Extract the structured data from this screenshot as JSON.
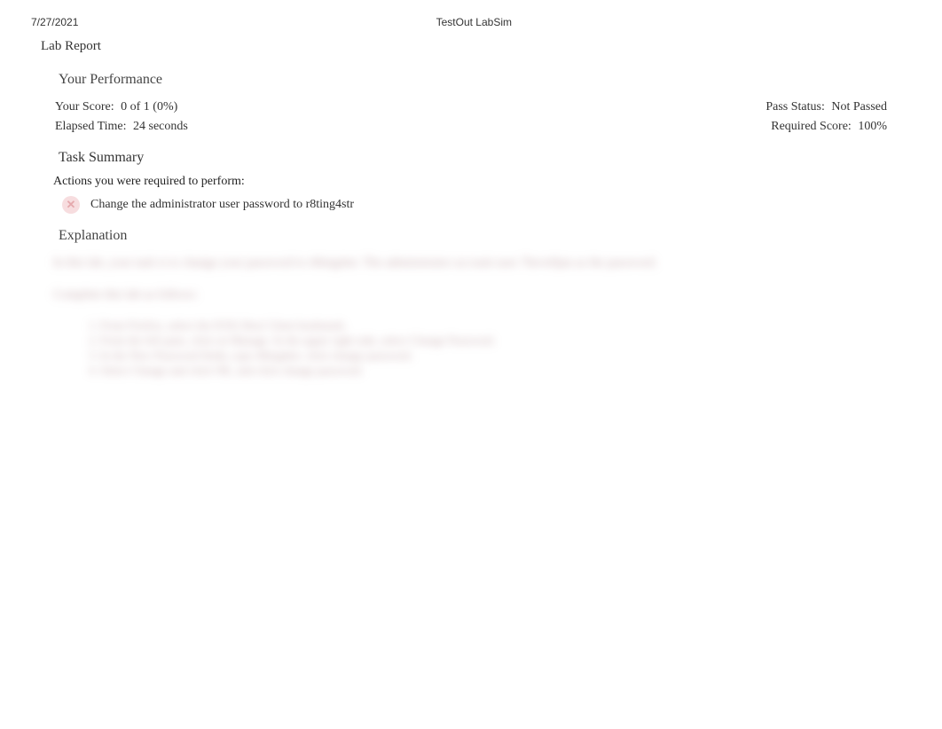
{
  "header": {
    "date": "7/27/2021",
    "app_title": "TestOut LabSim"
  },
  "report": {
    "title": "Lab Report"
  },
  "performance": {
    "section_title": "Your Performance",
    "score_label": "Your Score:",
    "score_value": "0 of 1 (0%)",
    "elapsed_label": "Elapsed Time:",
    "elapsed_value": "24 seconds",
    "pass_label": "Pass Status:",
    "pass_value": "Not Passed",
    "required_label": "Required Score:",
    "required_value": "100%"
  },
  "task_summary": {
    "section_title": "Task Summary",
    "actions_label": "Actions you were required to perform:",
    "task_1": "Change the administrator user password to r8ting4str",
    "fail_glyph": "✕"
  },
  "explanation": {
    "section_title": "Explanation",
    "blurred_line_1": "In this lab, your task is to change your password to r8ting4str. The administrator account uses 7hevn9jan as the password.",
    "blurred_line_2": "Complete this lab as follows:",
    "blurred_item_1": "1. From Firefox, select the ESXi Host Client bookmark.",
    "blurred_item_2": "2. From the left pane, click on Manage. In the upper right side, select Change Password.",
    "blurred_item_3": "3. In the New Password fields, type r8ting4str. click change password.",
    "blurred_item_4": "4. Select Change and click OK, and click change password."
  }
}
